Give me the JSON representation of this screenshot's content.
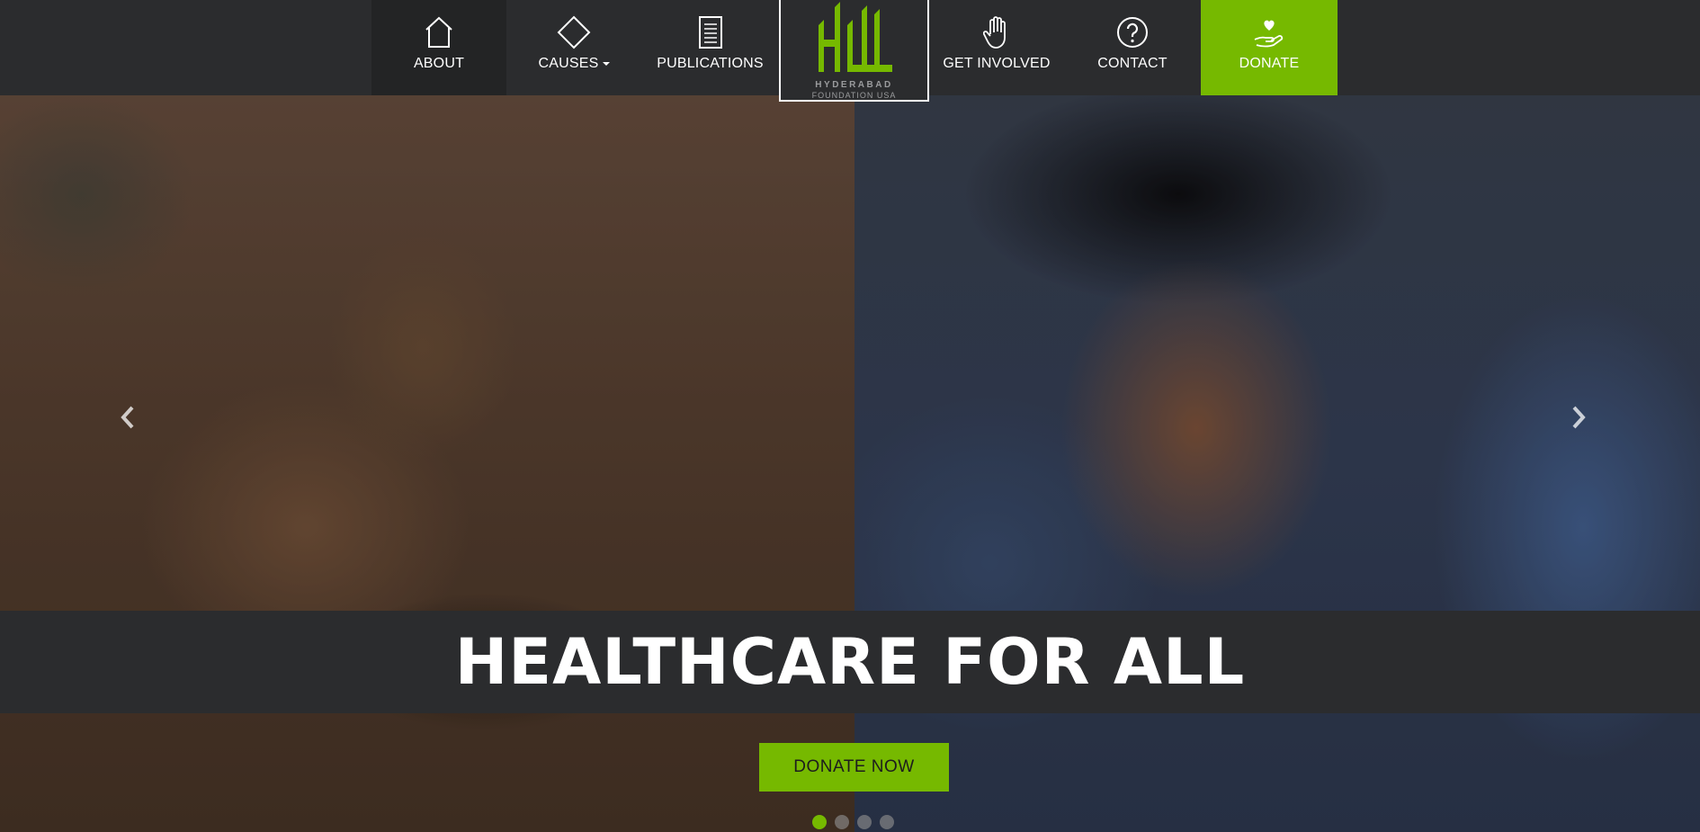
{
  "nav": {
    "items": [
      {
        "label": "ABOUT",
        "icon": "house-icon"
      },
      {
        "label": "CAUSES",
        "icon": "diamond-icon"
      },
      {
        "label": "PUBLICATIONS",
        "icon": "document-icon"
      },
      {
        "label": "GET INVOLVED",
        "icon": "raised-hand-icon"
      },
      {
        "label": "CONTACT",
        "icon": "question-circle-icon"
      },
      {
        "label": "DONATE",
        "icon": "heart-in-hand-icon"
      }
    ]
  },
  "logo": {
    "line1": "HYDERABAD",
    "line2": "FOUNDATION USA"
  },
  "hero": {
    "headline": "HEALTHCARE FOR ALL",
    "cta_label": "DONATE NOW",
    "slide_count": 4,
    "active_slide": 1
  },
  "colors": {
    "accent": "#76b900",
    "nav_bg": "#2b2c2e",
    "text": "#ffffff"
  }
}
